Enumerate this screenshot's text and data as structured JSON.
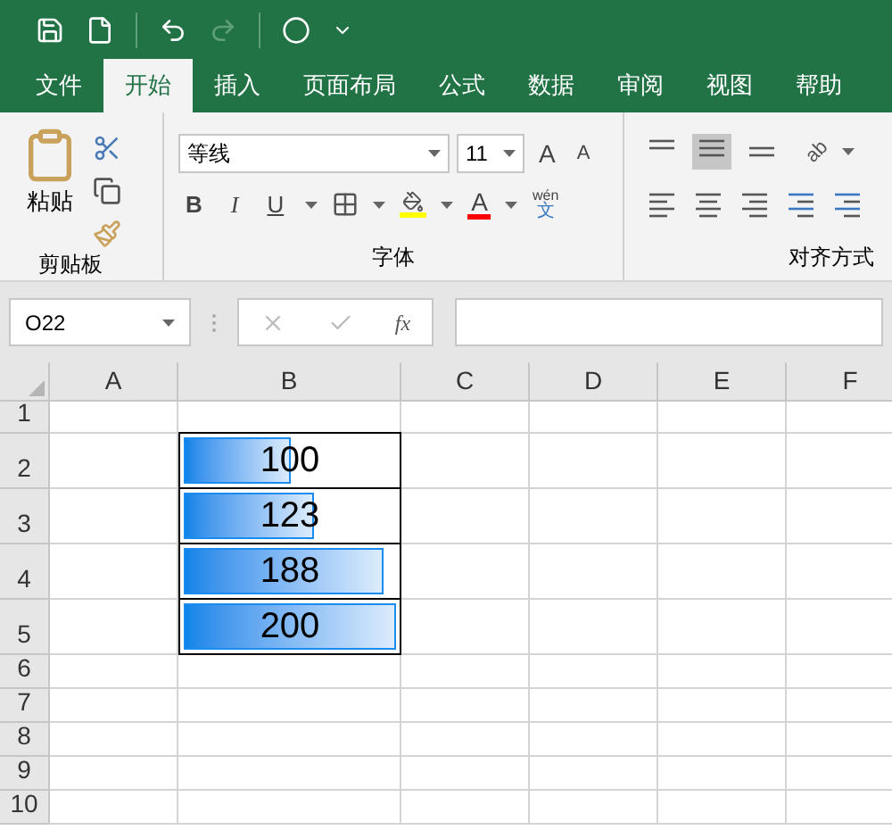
{
  "ribbon_tabs": [
    {
      "label": "文件",
      "selected": false
    },
    {
      "label": "开始",
      "selected": true
    },
    {
      "label": "插入",
      "selected": false
    },
    {
      "label": "页面布局",
      "selected": false
    },
    {
      "label": "公式",
      "selected": false
    },
    {
      "label": "数据",
      "selected": false
    },
    {
      "label": "审阅",
      "selected": false
    },
    {
      "label": "视图",
      "selected": false
    },
    {
      "label": "帮助",
      "selected": false
    }
  ],
  "clipboard": {
    "paste_label": "粘贴",
    "group_label": "剪贴板"
  },
  "font": {
    "font_name": "等线",
    "font_size": "11",
    "grow_glyph": "A",
    "shrink_glyph": "A",
    "bold": "B",
    "italic": "I",
    "underline": "U",
    "font_color_glyph": "A",
    "phonetic_top": "wén",
    "phonetic_bottom": "文",
    "group_label": "字体"
  },
  "alignment": {
    "group_label": "对齐方式",
    "wrap_glyph": "ab"
  },
  "formula_bar": {
    "name_box": "O22",
    "fx": "fx"
  },
  "sheet": {
    "columns": [
      "A",
      "B",
      "C",
      "D",
      "E",
      "F"
    ],
    "rows": [
      {
        "label": "1",
        "b": null
      },
      {
        "label": "2",
        "b": {
          "value": "100",
          "level": 0.5
        }
      },
      {
        "label": "3",
        "b": {
          "value": "123",
          "level": 0.615
        }
      },
      {
        "label": "4",
        "b": {
          "value": "188",
          "level": 0.94
        }
      },
      {
        "label": "5",
        "b": {
          "value": "200",
          "level": 1
        }
      },
      {
        "label": "6",
        "b": null
      },
      {
        "label": "7",
        "b": null
      },
      {
        "label": "8",
        "b": null
      },
      {
        "label": "9",
        "b": null
      },
      {
        "label": "10",
        "b": null
      }
    ]
  }
}
